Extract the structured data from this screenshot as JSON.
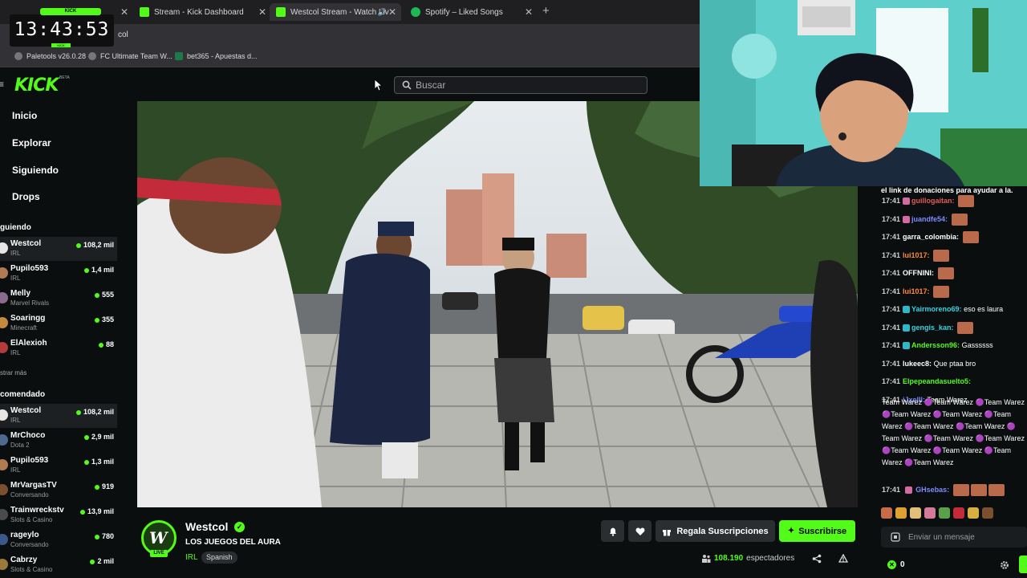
{
  "browser": {
    "tabs": [
      {
        "label": "",
        "active": false
      },
      {
        "label": "Stream - Kick Dashboard",
        "active": false
      },
      {
        "label": "Westcol Stream - Watch Liv",
        "active": true
      },
      {
        "label": "Spotify – Liked Songs",
        "active": false
      }
    ],
    "address_fragment": "col",
    "bookmarks": [
      "Paletools v26.0.28",
      "FC Ultimate Team W...",
      "bet365 - Apuestas d..."
    ]
  },
  "clock": {
    "time": "13:43:53",
    "tag": "KICK",
    "sub": "KICK"
  },
  "header": {
    "logo": "KICK",
    "beta": "BETA",
    "search_placeholder": "Buscar"
  },
  "sidebar": {
    "nav": [
      "Inicio",
      "Explorar",
      "Siguiendo",
      "Drops"
    ],
    "following_title": "guiendo",
    "following": [
      {
        "name": "Westcol",
        "category": "IRL",
        "viewers": "108,2 mil",
        "selected": true,
        "color": "#e6e6e6"
      },
      {
        "name": "Pupilo593",
        "category": "IRL",
        "viewers": "1,4 mil",
        "selected": false,
        "color": "#b07a52"
      },
      {
        "name": "Melly",
        "category": "Marvel Rivals",
        "viewers": "555",
        "selected": false,
        "color": "#8a6b8e"
      },
      {
        "name": "Soaringg",
        "category": "Minecraft",
        "viewers": "355",
        "selected": false,
        "color": "#c58a3b"
      },
      {
        "name": "ElAlexioh",
        "category": "IRL",
        "viewers": "88",
        "selected": false,
        "color": "#b33b3b"
      }
    ],
    "show_more": "strar más",
    "recommended_title": "comendado",
    "recommended": [
      {
        "name": "Westcol",
        "category": "IRL",
        "viewers": "108,2 mil",
        "selected": true,
        "color": "#e6e6e6"
      },
      {
        "name": "MrChoco",
        "category": "Dota 2",
        "viewers": "2,9 mil",
        "selected": false,
        "color": "#4d6a8e"
      },
      {
        "name": "Pupilo593",
        "category": "IRL",
        "viewers": "1,3 mil",
        "selected": false,
        "color": "#b07a52"
      },
      {
        "name": "MrVargasTV",
        "category": "Conversando",
        "viewers": "919",
        "selected": false,
        "color": "#7a5030"
      },
      {
        "name": "Trainwreckstv",
        "category": "Slots & Casino",
        "viewers": "13,9 mil",
        "selected": false,
        "color": "#4b4b4b"
      },
      {
        "name": "rageylo",
        "category": "Conversando",
        "viewers": "780",
        "selected": false,
        "color": "#3a5a8a"
      },
      {
        "name": "Cabrzy",
        "category": "Slots & Casino",
        "viewers": "2 mil",
        "selected": false,
        "color": "#9a7a3a"
      }
    ]
  },
  "stream": {
    "streamer": "Westcol",
    "live_label": "LIVE",
    "avatar_letter": "W",
    "title": "LOS JUEGOS DEL AURA",
    "category": "IRL",
    "tag": "Spanish",
    "gift_label": "Regala Suscripciones",
    "subscribe_label": "Suscribirse",
    "viewers": "108.190",
    "viewers_label": "espectadores"
  },
  "chat": {
    "top_line": "el link de donaciones para ayudar a la.",
    "messages": [
      {
        "time": "17:41",
        "user": "guillogaitan:",
        "color": "#e05a5a",
        "badge": "#d46aa0",
        "text": "",
        "emotes": 1
      },
      {
        "time": "17:41",
        "user": "juandfe54:",
        "color": "#7c8cff",
        "badge": "#d46aa0",
        "text": "",
        "emotes": 1
      },
      {
        "time": "17:41",
        "user": "garra_colombia:",
        "color": "#ffffff",
        "badge": "",
        "text": "",
        "emotes": 1
      },
      {
        "time": "17:41",
        "user": "lui1017:",
        "color": "#ff8a3a",
        "badge": "",
        "text": "",
        "emotes": 1
      },
      {
        "time": "17:41",
        "user": "OFFNINI:",
        "color": "#ffffff",
        "badge": "",
        "text": "",
        "emotes": 1
      },
      {
        "time": "17:41",
        "user": "lui1017:",
        "color": "#ff8a3a",
        "badge": "",
        "text": "",
        "emotes": 1
      },
      {
        "time": "17:41",
        "user": "Yairmoreno69:",
        "color": "#3ad1e0",
        "badge": "#2fb6c8",
        "text": "eso es laura",
        "emotes": 0
      },
      {
        "time": "17:41",
        "user": "gengis_kan:",
        "color": "#3ad1e0",
        "badge": "#2fb6c8",
        "text": "",
        "emotes": 1
      },
      {
        "time": "17:41",
        "user": "Andersson96:",
        "color": "#53fc18",
        "badge": "#2fb6c8",
        "text": "Gassssss",
        "emotes": 0
      },
      {
        "time": "17:41",
        "user": "lukeec8:",
        "color": "#ffffff",
        "badge": "",
        "text": "Que ptaa bro",
        "emotes": 0
      },
      {
        "time": "17:41",
        "user": "Elpepeandasuelto5:",
        "color": "#53fc18",
        "badge": "",
        "text": "",
        "emotes": 0
      },
      {
        "time": "17:41",
        "user": "iJxelll:",
        "color": "#7c8cff",
        "badge": "",
        "text": "Team Warez",
        "emotes": 0
      }
    ],
    "warez_text": "Team Warez 🟣Team Warez 🟣Team Warez 🟣Team Warez 🟣Team Warez 🟣Team Warez 🟣Team Warez 🟣Team Warez 🟣Team Warez 🟣Team Warez 🟣Team Warez 🟣Team Warez 🟣Team Warez 🟣Team Warez 🟣Team Warez",
    "last": {
      "time": "17:41",
      "user": "GHsebas:",
      "color": "#7c8cff",
      "badge": "#d46aa0"
    },
    "input_placeholder": "Enviar un mensaje",
    "points": "0"
  },
  "colors": {
    "accent": "#53fc18",
    "bg": "#0b0e0f"
  }
}
